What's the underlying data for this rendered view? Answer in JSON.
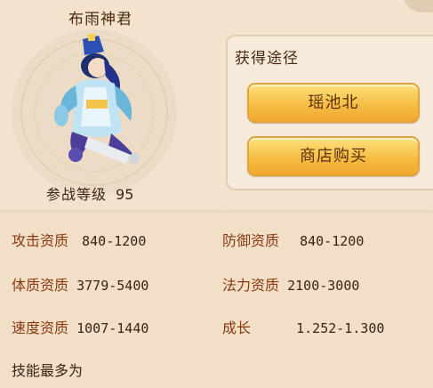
{
  "pet": {
    "name": "布雨神君",
    "level_label": "参战等级",
    "level_value": "95"
  },
  "obtain": {
    "title": "获得途径",
    "buttons": [
      "瑶池北",
      "商店购买"
    ]
  },
  "stats": {
    "attack": {
      "label": "攻击资质",
      "value": "840-1200"
    },
    "defense": {
      "label": "防御资质",
      "value": "840-1200"
    },
    "physique": {
      "label": "体质资质",
      "value": "3779-5400"
    },
    "magic": {
      "label": "法力资质",
      "value": "2100-3000"
    },
    "speed": {
      "label": "速度资质",
      "value": "1007-1440"
    },
    "growth": {
      "label": "成长",
      "value": "1.252-1.300"
    }
  },
  "skills": {
    "title": "技能最多为"
  },
  "colors": {
    "accent_button": "#f6bd45",
    "stat_label": "#8a3a10",
    "text": "#3a2414"
  }
}
